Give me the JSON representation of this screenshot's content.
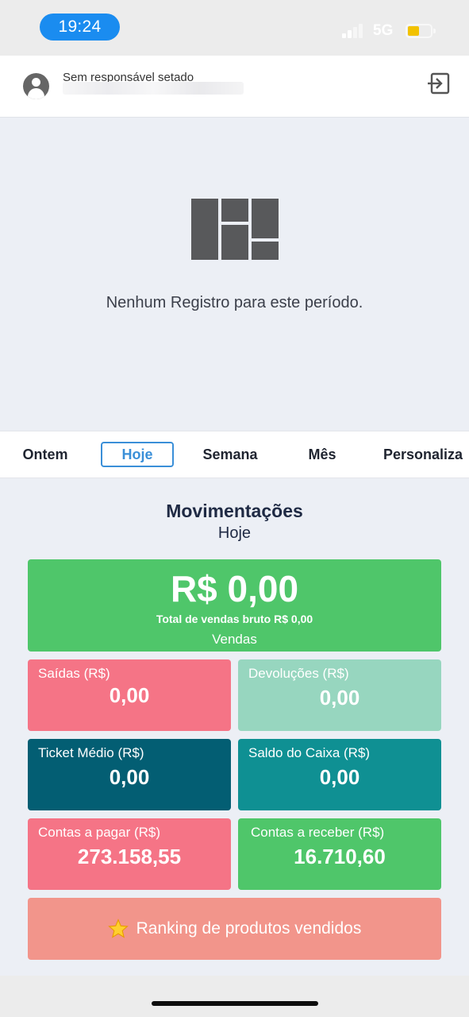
{
  "status_bar": {
    "time": "19:24",
    "network": "5G"
  },
  "header": {
    "responsible_label": "Sem responsável setado",
    "logout_icon": "logout-icon"
  },
  "empty_state": {
    "message": "Nenhum Registro para este período."
  },
  "tabs": [
    {
      "label": "Ontem",
      "active": false
    },
    {
      "label": "Hoje",
      "active": true
    },
    {
      "label": "Semana",
      "active": false
    },
    {
      "label": "Mês",
      "active": false
    },
    {
      "label": "Personaliza",
      "active": false
    }
  ],
  "movimentacoes": {
    "title": "Movimentações",
    "period": "Hoje"
  },
  "vendas": {
    "amount": "R$ 0,00",
    "gross_label": "Total de vendas bruto R$ 0,00",
    "name": "Vendas"
  },
  "cards": {
    "saidas": {
      "label": "Saídas (R$)",
      "value": "0,00"
    },
    "devolucoes": {
      "label": "Devoluções (R$)",
      "value": "0,00"
    },
    "ticket_medio": {
      "label": "Ticket Médio (R$)",
      "value": "0,00"
    },
    "saldo_caixa": {
      "label": "Saldo do Caixa (R$)",
      "value": "0,00"
    },
    "contas_pagar": {
      "label": "Contas a pagar (R$)",
      "value": "273.158,55"
    },
    "contas_receber": {
      "label": "Contas a receber (R$)",
      "value": "16.710,60"
    }
  },
  "ranking": {
    "label": "Ranking de produtos vendidos",
    "icon": "star-icon"
  },
  "colors": {
    "green": "#4fc66a",
    "red": "#f57486",
    "mint": "#97d6bf",
    "dark_teal": "#035e73",
    "teal": "#0f9093",
    "salmon": "#f2958b",
    "accent": "#3a8fd8",
    "time_pill": "#1a8cf0"
  }
}
